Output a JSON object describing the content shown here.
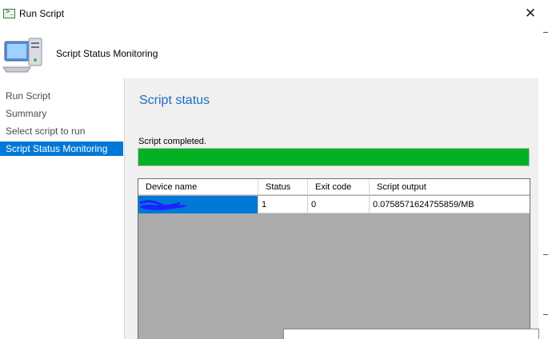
{
  "window": {
    "title": "Run Script"
  },
  "header": {
    "title": "Script Status Monitoring"
  },
  "sidebar": {
    "items": [
      {
        "label": "Run Script",
        "active": false
      },
      {
        "label": "Summary",
        "active": false
      },
      {
        "label": "Select script to run",
        "active": false
      },
      {
        "label": "Script Status Monitoring",
        "active": true
      }
    ]
  },
  "main": {
    "section_title": "Script status",
    "status_text": "Script completed.",
    "progress_percent": 100,
    "columns": [
      "Device name",
      "Status",
      "Exit code",
      "Script output"
    ],
    "rows": [
      {
        "device_name": "",
        "status": "1",
        "exit_code": "0",
        "script_output": "0.0758571624755859/MB"
      }
    ]
  },
  "colors": {
    "accent": "#0078d7",
    "progress": "#06b025",
    "section_title": "#1f6cc4"
  },
  "icons": {
    "title": "script-window-icon",
    "header": "computer-icon",
    "close": "close-icon"
  }
}
